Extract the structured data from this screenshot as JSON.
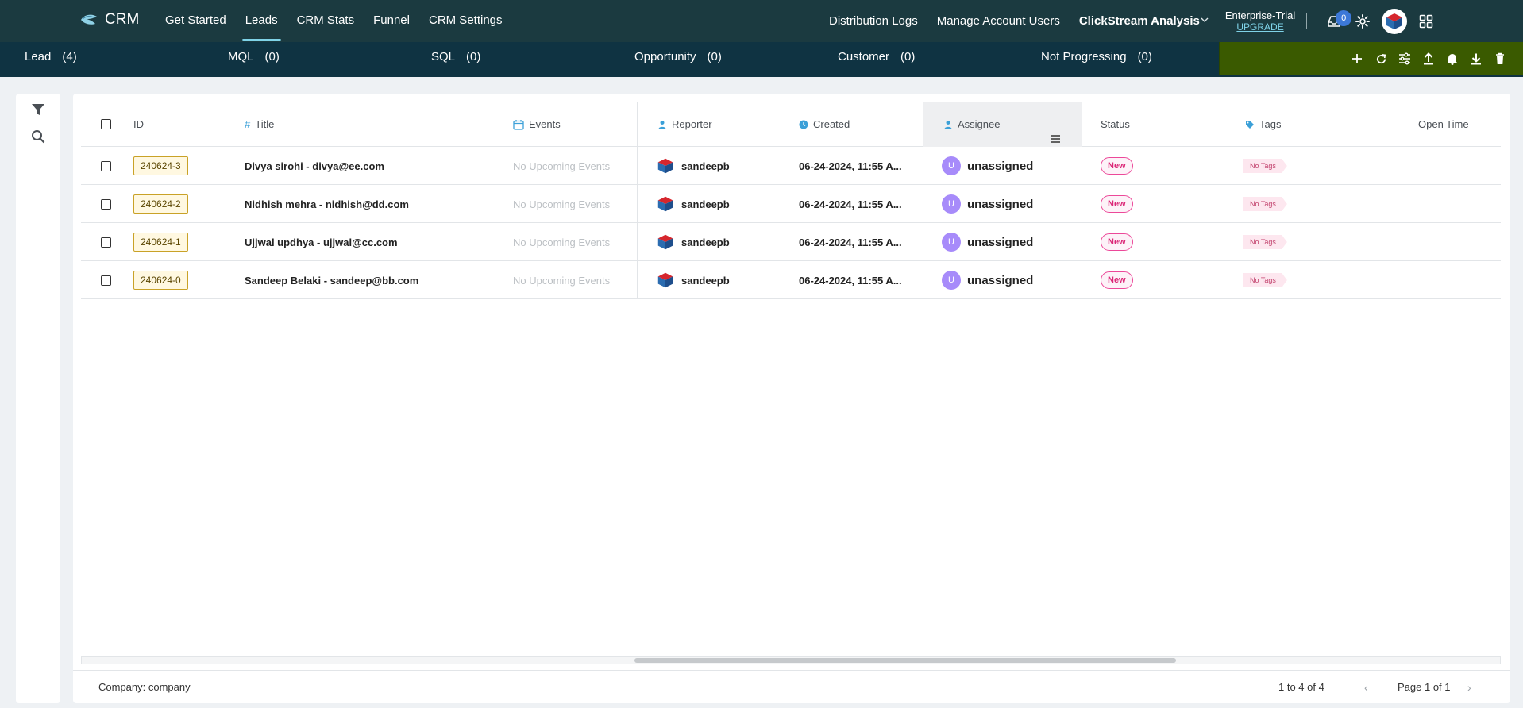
{
  "brand": {
    "name": "CRM",
    "logo_icon": "fish-logo-icon"
  },
  "nav_left": [
    {
      "label": "Get Started",
      "active": false
    },
    {
      "label": "Leads",
      "active": true
    },
    {
      "label": "CRM Stats",
      "active": false
    },
    {
      "label": "Funnel",
      "active": false
    },
    {
      "label": "CRM Settings",
      "active": false
    }
  ],
  "nav_right": {
    "distribution_logs": "Distribution Logs",
    "manage_users": "Manage Account Users",
    "clickstream": "ClickStream Analysis",
    "plan_name": "Enterprise-Trial",
    "plan_upgrade": "UPGRADE",
    "inbox_badge": "0"
  },
  "stages": [
    {
      "label": "Lead",
      "count": "(4)"
    },
    {
      "label": "MQL",
      "count": "(0)"
    },
    {
      "label": "SQL",
      "count": "(0)"
    },
    {
      "label": "Opportunity",
      "count": "(0)"
    },
    {
      "label": "Customer",
      "count": "(0)"
    },
    {
      "label": "Not Progressing",
      "count": "(0)"
    }
  ],
  "actions": [
    "plus-icon",
    "refresh-icon",
    "sliders-icon",
    "upload-icon",
    "bell-icon",
    "download-icon",
    "trash-icon"
  ],
  "columns": {
    "id": "ID",
    "title": "Title",
    "events": "Events",
    "reporter": "Reporter",
    "created": "Created",
    "assignee": "Assignee",
    "status": "Status",
    "tags": "Tags",
    "open_time": "Open Time"
  },
  "rows": [
    {
      "id": "240624-3",
      "title": "Divya sirohi - divya@ee.com",
      "events": "No Upcoming Events",
      "reporter": "sandeepb",
      "created": "06-24-2024, 11:55 A...",
      "assignee_initial": "U",
      "assignee": "unassigned",
      "status": "New",
      "tags": "No Tags"
    },
    {
      "id": "240624-2",
      "title": "Nidhish mehra - nidhish@dd.com",
      "events": "No Upcoming Events",
      "reporter": "sandeepb",
      "created": "06-24-2024, 11:55 A...",
      "assignee_initial": "U",
      "assignee": "unassigned",
      "status": "New",
      "tags": "No Tags"
    },
    {
      "id": "240624-1",
      "title": "Ujjwal updhya - ujjwal@cc.com",
      "events": "No Upcoming Events",
      "reporter": "sandeepb",
      "created": "06-24-2024, 11:55 A...",
      "assignee_initial": "U",
      "assignee": "unassigned",
      "status": "New",
      "tags": "No Tags"
    },
    {
      "id": "240624-0",
      "title": "Sandeep Belaki - sandeep@bb.com",
      "events": "No Upcoming Events",
      "reporter": "sandeepb",
      "created": "06-24-2024, 11:55 A...",
      "assignee_initial": "U",
      "assignee": "unassigned",
      "status": "New",
      "tags": "No Tags"
    }
  ],
  "footer": {
    "company": "Company: company",
    "range": "1 to 4 of 4",
    "page": "Page 1 of 1"
  },
  "colors": {
    "topbar": "#1b3a40",
    "stagebar": "#0f3342",
    "actionbar": "#3a5a00",
    "accent": "#7fd3e8"
  }
}
